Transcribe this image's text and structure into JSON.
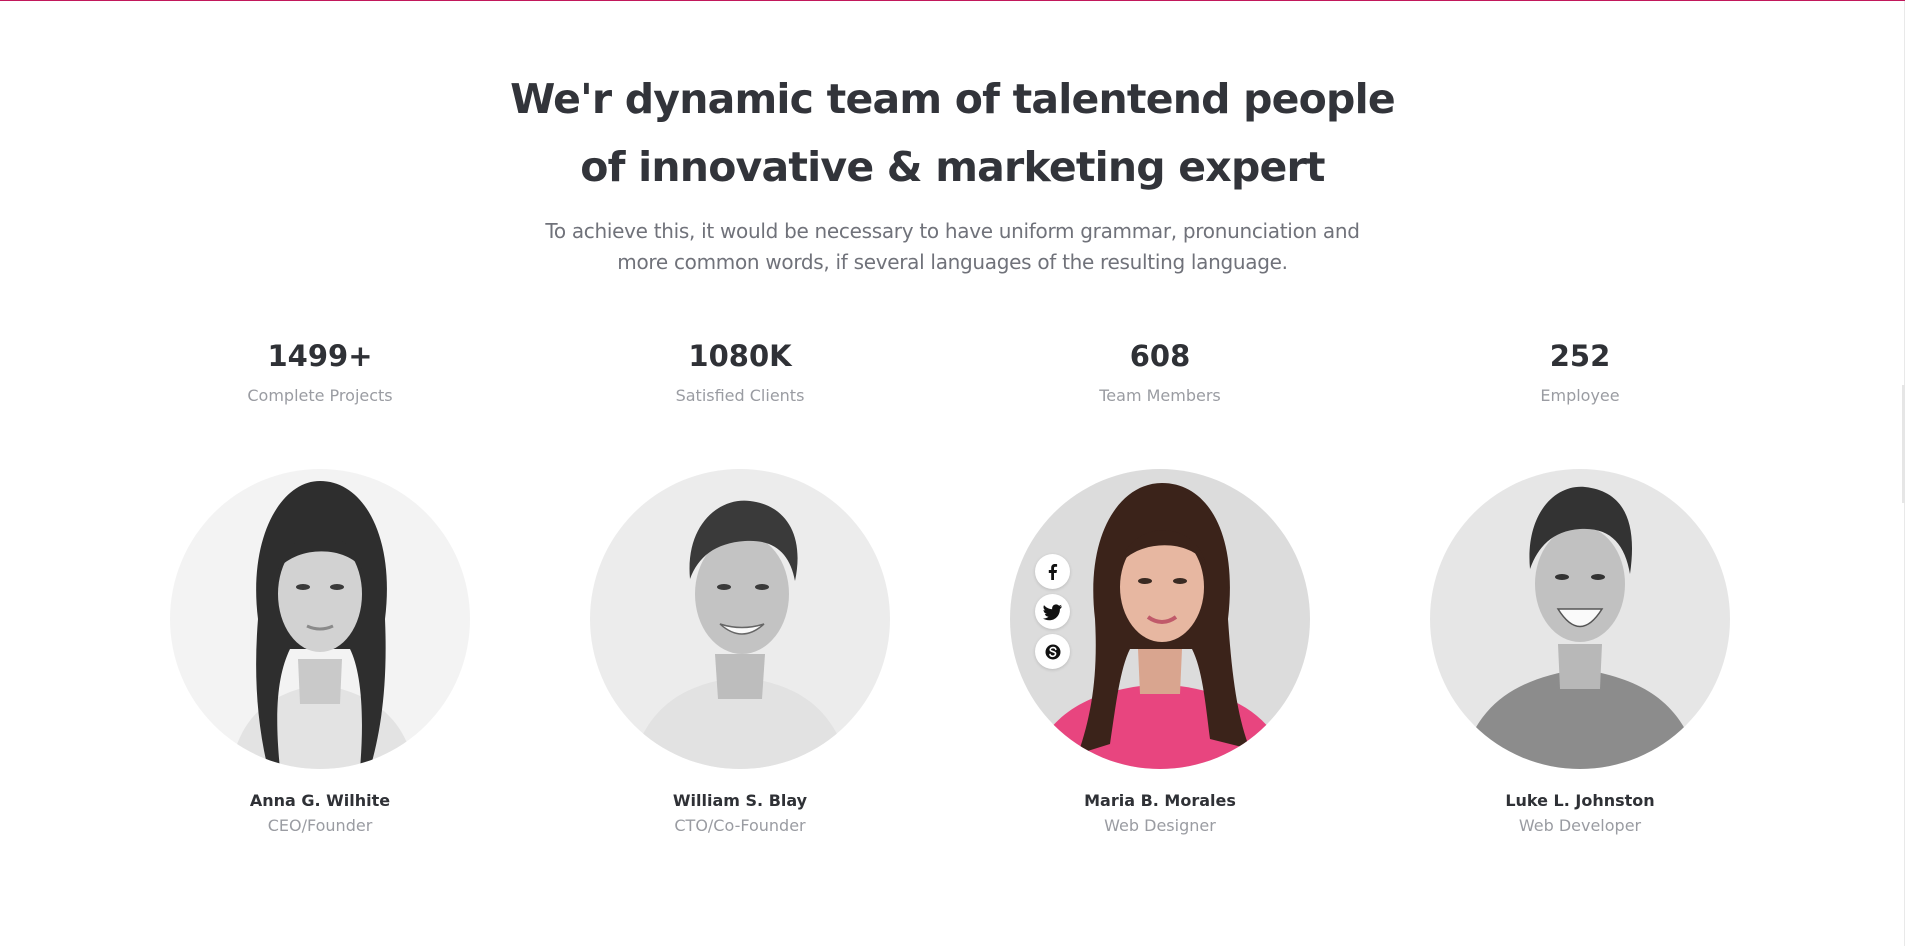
{
  "section": {
    "heading_line1": "We'r dynamic team of talentend people",
    "heading_line2": "of innovative & marketing expert",
    "subtitle_line1": "To achieve this, it would be necessary to have uniform grammar, pronunciation and",
    "subtitle_line2": "more common words, if several languages of the resulting language."
  },
  "stats": [
    {
      "value": "1499+",
      "label": "Complete Projects"
    },
    {
      "value": "1080K",
      "label": "Satisfied Clients"
    },
    {
      "value": "608",
      "label": "Team Members"
    },
    {
      "value": "252",
      "label": "Employee"
    }
  ],
  "team": [
    {
      "name": "Anna G. Wilhite",
      "role": "CEO/Founder"
    },
    {
      "name": "William S. Blay",
      "role": "CTO/Co-Founder"
    },
    {
      "name": "Maria B. Morales",
      "role": "Web Designer"
    },
    {
      "name": "Luke L. Johnston",
      "role": "Web Developer"
    }
  ],
  "social_icons": [
    "facebook-icon",
    "twitter-icon",
    "skype-icon"
  ],
  "colors": {
    "accent_top_border": "#c2185b",
    "heading": "#32343a",
    "muted": "#9a9ca2",
    "sweater_pink": "#e8457f"
  }
}
